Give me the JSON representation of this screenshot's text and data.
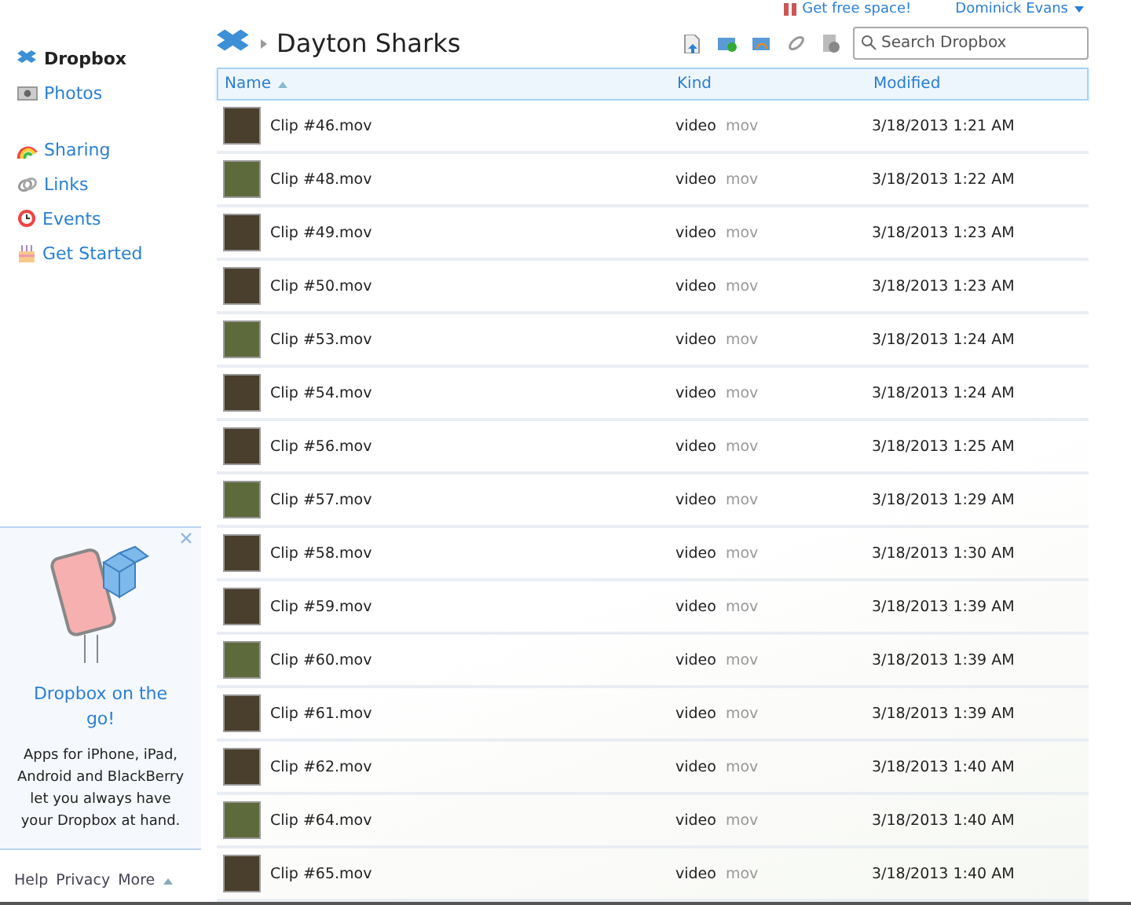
{
  "top_links": {
    "free_space": "Get free space!",
    "user": "Dominick Evans"
  },
  "sidebar": {
    "items": [
      {
        "label": "Dropbox",
        "selected": true
      },
      {
        "label": "Photos",
        "selected": false
      },
      {
        "label": "Sharing",
        "selected": false
      },
      {
        "label": "Links",
        "selected": false
      },
      {
        "label": "Events",
        "selected": false
      },
      {
        "label": "Get Started",
        "selected": false
      }
    ],
    "promo": {
      "title": "Dropbox on the go!",
      "text": "Apps for iPhone, iPad, Android and BlackBerry let you always have your Dropbox at hand."
    },
    "footer": [
      "Help",
      "Privacy",
      "More"
    ]
  },
  "header": {
    "title": "Dayton Sharks",
    "search": {
      "placeholder": "Search Dropbox"
    }
  },
  "table": {
    "columns": [
      {
        "label": "Name",
        "sorted": true
      },
      {
        "label": "Kind",
        "sorted": false
      },
      {
        "label": "Modified",
        "sorted": false
      }
    ],
    "rows": [
      {
        "name": "Clip #46.mov",
        "kind": "video",
        "ext": "mov",
        "modified": "3/18/2013 1:21 AM"
      },
      {
        "name": "Clip #48.mov",
        "kind": "video",
        "ext": "mov",
        "modified": "3/18/2013 1:22 AM"
      },
      {
        "name": "Clip #49.mov",
        "kind": "video",
        "ext": "mov",
        "modified": "3/18/2013 1:23 AM"
      },
      {
        "name": "Clip #50.mov",
        "kind": "video",
        "ext": "mov",
        "modified": "3/18/2013 1:23 AM"
      },
      {
        "name": "Clip #53.mov",
        "kind": "video",
        "ext": "mov",
        "modified": "3/18/2013 1:24 AM"
      },
      {
        "name": "Clip #54.mov",
        "kind": "video",
        "ext": "mov",
        "modified": "3/18/2013 1:24 AM"
      },
      {
        "name": "Clip #56.mov",
        "kind": "video",
        "ext": "mov",
        "modified": "3/18/2013 1:25 AM"
      },
      {
        "name": "Clip #57.mov",
        "kind": "video",
        "ext": "mov",
        "modified": "3/18/2013 1:29 AM"
      },
      {
        "name": "Clip #58.mov",
        "kind": "video",
        "ext": "mov",
        "modified": "3/18/2013 1:30 AM"
      },
      {
        "name": "Clip #59.mov",
        "kind": "video",
        "ext": "mov",
        "modified": "3/18/2013 1:39 AM"
      },
      {
        "name": "Clip #60.mov",
        "kind": "video",
        "ext": "mov",
        "modified": "3/18/2013 1:39 AM"
      },
      {
        "name": "Clip #61.mov",
        "kind": "video",
        "ext": "mov",
        "modified": "3/18/2013 1:39 AM"
      },
      {
        "name": "Clip #62.mov",
        "kind": "video",
        "ext": "mov",
        "modified": "3/18/2013 1:40 AM"
      },
      {
        "name": "Clip #64.mov",
        "kind": "video",
        "ext": "mov",
        "modified": "3/18/2013 1:40 AM"
      },
      {
        "name": "Clip #65.mov",
        "kind": "video",
        "ext": "mov",
        "modified": "3/18/2013 1:40 AM"
      }
    ]
  }
}
